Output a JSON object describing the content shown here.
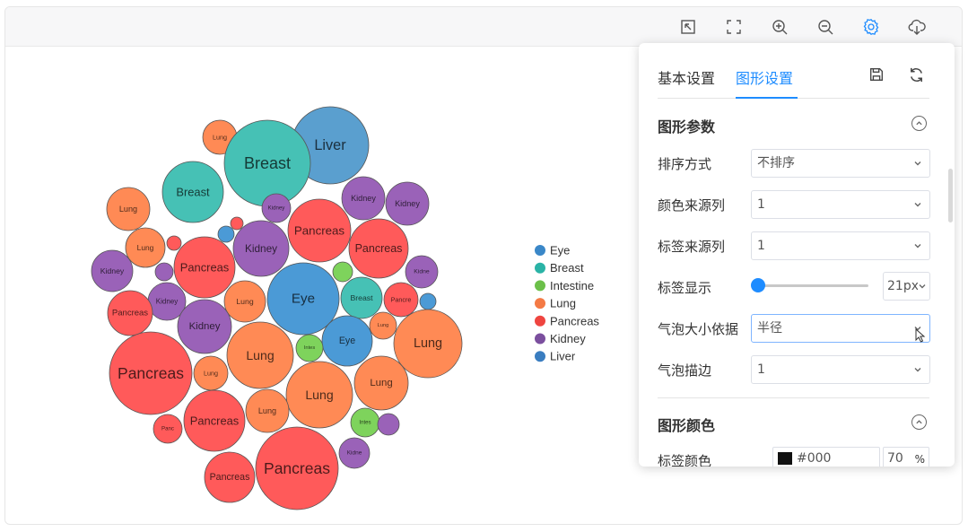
{
  "toolbar": {
    "icons": [
      "select-area-icon",
      "fullscreen-icon",
      "zoom-in-icon",
      "zoom-out-icon",
      "settings-icon",
      "download-icon"
    ],
    "active_icon": "settings-icon",
    "accent": "#1e8cff"
  },
  "panel": {
    "tabs": [
      {
        "label": "基本设置"
      },
      {
        "label": "图形设置"
      }
    ],
    "active_tab": 1,
    "section1_title": "图形参数",
    "rows": {
      "sort": {
        "label": "排序方式",
        "value": "不排序"
      },
      "color_col": {
        "label": "颜色来源列",
        "value": "1"
      },
      "label_col": {
        "label": "标签来源列",
        "value": "1"
      },
      "label_show": {
        "label": "标签显示",
        "value": "21px"
      },
      "size_by": {
        "label": "气泡大小依据",
        "value": "半径"
      },
      "stroke": {
        "label": "气泡描边",
        "value": "1"
      }
    },
    "section2_title": "图形颜色",
    "label_color": {
      "label": "标签颜色",
      "hex": "#000",
      "opacity": "70",
      "unit": "%"
    }
  },
  "chart_data": {
    "type": "bubble",
    "legend": [
      {
        "name": "Eye",
        "color": "#3a87c8"
      },
      {
        "name": "Breast",
        "color": "#2ab3a6"
      },
      {
        "name": "Intestine",
        "color": "#6cc04a"
      },
      {
        "name": "Lung",
        "color": "#f47a45"
      },
      {
        "name": "Pancreas",
        "color": "#ef4540"
      },
      {
        "name": "Kidney",
        "color": "#7b4f9e"
      },
      {
        "name": "Liver",
        "color": "#3a7dc0"
      }
    ],
    "bubbles": [
      {
        "label": "Lung",
        "group": "Lung",
        "value": 19
      },
      {
        "label": "Breast",
        "group": "Breast",
        "value": 34
      },
      {
        "label": "Liver",
        "group": "Liver",
        "value": 43
      },
      {
        "label": "Breast",
        "group": "Breast",
        "value": 48
      },
      {
        "label": "Lung",
        "group": "Lung",
        "value": 24
      },
      {
        "label": "Kidney",
        "group": "Kidney",
        "value": 16
      },
      {
        "label": "Pancreas",
        "group": "Pancreas",
        "value": 35
      },
      {
        "label": "Kidney",
        "group": "Kidney",
        "value": 24
      },
      {
        "label": "Kidney",
        "group": "Kidney",
        "value": 24
      },
      {
        "label": "Lung",
        "group": "Lung",
        "value": 22
      },
      {
        "label": "",
        "group": "Pancreas",
        "value": 8
      },
      {
        "label": "",
        "group": "Pancreas",
        "value": 7
      },
      {
        "label": "",
        "group": "Eye",
        "value": 9
      },
      {
        "label": "Kidney",
        "group": "Kidney",
        "value": 31
      },
      {
        "label": "Pancreas",
        "group": "Pancreas",
        "value": 34
      },
      {
        "label": "Kidney",
        "group": "Kidney",
        "value": 23
      },
      {
        "label": "Pancreas",
        "group": "Pancreas",
        "value": 33
      },
      {
        "label": "",
        "group": "Kidney",
        "value": 10
      },
      {
        "label": "Eye",
        "group": "Eye",
        "value": 40
      },
      {
        "label": "",
        "group": "Intestine",
        "value": 11
      },
      {
        "label": "Breast",
        "group": "Breast",
        "value": 23
      },
      {
        "label": "Kidne",
        "group": "Kidney",
        "value": 18
      },
      {
        "label": "Kidney",
        "group": "Kidney",
        "value": 21
      },
      {
        "label": "Lung",
        "group": "Lung",
        "value": 23
      },
      {
        "label": "Pancre",
        "group": "Pancreas",
        "value": 19
      },
      {
        "label": "",
        "group": "Eye",
        "value": 9
      },
      {
        "label": "Pancreas",
        "group": "Pancreas",
        "value": 25
      },
      {
        "label": "Kidney",
        "group": "Kidney",
        "value": 30
      },
      {
        "label": "Lung",
        "group": "Lung",
        "value": 15
      },
      {
        "label": "Eye",
        "group": "Eye",
        "value": 28
      },
      {
        "label": "Lung",
        "group": "Lung",
        "value": 37
      },
      {
        "label": "Lung",
        "group": "Lung",
        "value": 38
      },
      {
        "label": "Intes",
        "group": "Intestine",
        "value": 15
      },
      {
        "label": "Pancreas",
        "group": "Pancreas",
        "value": 46
      },
      {
        "label": "Lung",
        "group": "Lung",
        "value": 19
      },
      {
        "label": "Lung",
        "group": "Lung",
        "value": 37
      },
      {
        "label": "Lung",
        "group": "Lung",
        "value": 30
      },
      {
        "label": "Lung",
        "group": "Lung",
        "value": 24
      },
      {
        "label": "Pancreas",
        "group": "Pancreas",
        "value": 34
      },
      {
        "label": "Intes",
        "group": "Intestine",
        "value": 16
      },
      {
        "label": "",
        "group": "Kidney",
        "value": 12
      },
      {
        "label": "Panc",
        "group": "Pancreas",
        "value": 16
      },
      {
        "label": "Pancreas",
        "group": "Pancreas",
        "value": 28
      },
      {
        "label": "Pancreas",
        "group": "Pancreas",
        "value": 46
      },
      {
        "label": "Kidne",
        "group": "Kidney",
        "value": 17
      }
    ]
  }
}
